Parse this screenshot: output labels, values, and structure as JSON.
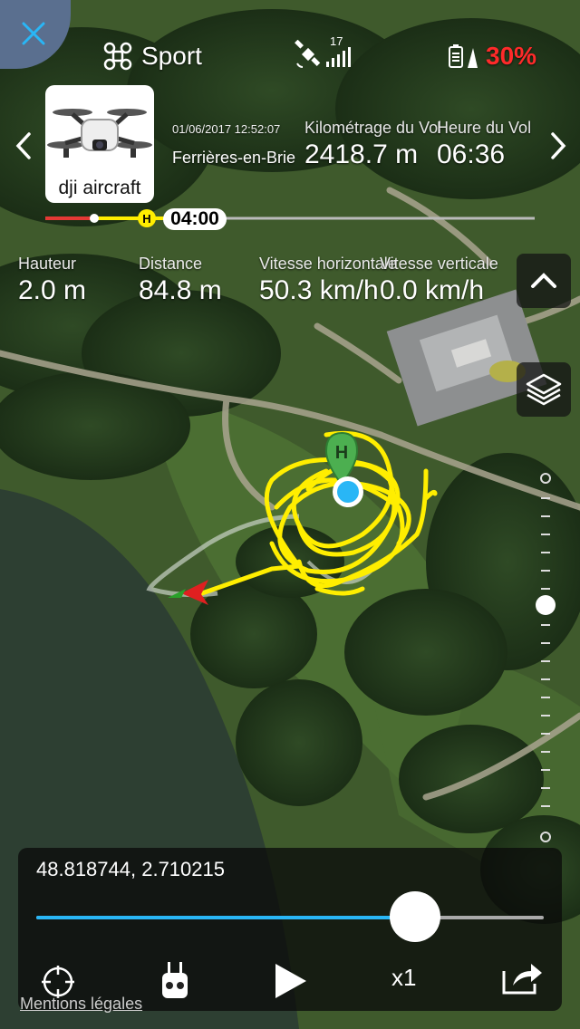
{
  "header": {
    "flight_mode": "Sport",
    "satellite_count": "17",
    "battery_percent": "30%",
    "colors": {
      "battery_alert": "#ff2a2a",
      "accent": "#29b6f6",
      "track": "#ffee00"
    }
  },
  "aircraft_card": {
    "name": "dji aircraft"
  },
  "flight_info": {
    "datetime": "01/06/2017 12:52:07",
    "location": "Ferrières-en-Brie",
    "distance_label": "Kilométrage du Vol",
    "distance_value": "2418.7 m",
    "duration_label": "Heure du Vol",
    "duration_value": "06:36"
  },
  "timeline": {
    "current_time": "04:00",
    "home_marker": "H",
    "progress": 0.19
  },
  "stats": [
    {
      "label": "Hauteur",
      "value": "2.0 m"
    },
    {
      "label": "Distance",
      "value": "84.8 m"
    },
    {
      "label": "Vitesse horizontale",
      "value": "50.3 km/h"
    },
    {
      "label": "Vitesse verticale",
      "value": "0.0 km/h"
    }
  ],
  "map": {
    "home_marker": "H",
    "icons": [
      "home-pin-icon",
      "aircraft-position-icon",
      "aircraft-heading-arrow-icon"
    ]
  },
  "playback": {
    "coordinates": "48.818744, 2.710215",
    "progress": 0.75,
    "speed": "x1"
  },
  "footer": {
    "legal_link": "Mentions légales"
  }
}
